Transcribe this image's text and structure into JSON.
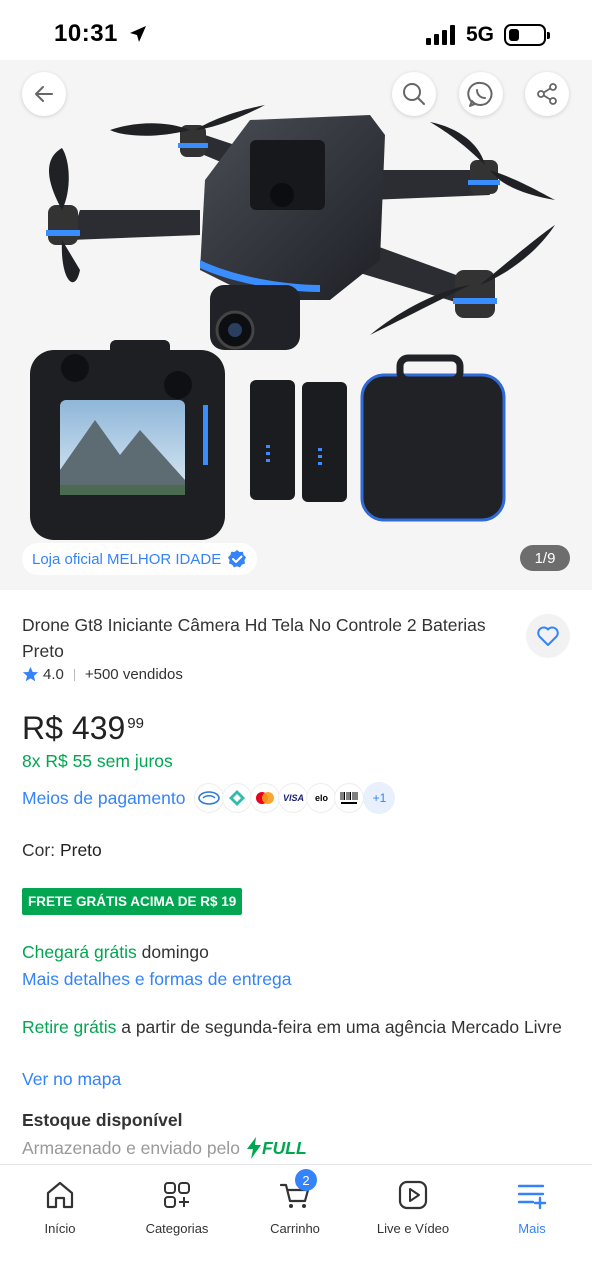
{
  "status_bar": {
    "time": "10:31",
    "network": "5G"
  },
  "hero": {
    "buttons": {
      "back": "back-icon",
      "search": "search-icon",
      "share_whatsapp": "whatsapp-share-icon",
      "share": "share-icon"
    },
    "store_badge": "Loja oficial MELHOR IDADE",
    "image_counter": "1/9"
  },
  "product": {
    "title": "Drone Gt8 Iniciante Câmera Hd Tela No Controle 2 Baterias Preto",
    "rating": "4.0",
    "sold": "+500 vendidos",
    "price_currency": "R$",
    "price_main": "439",
    "price_cents": "99",
    "installments": "8x R$ 55 sem juros",
    "payment_label": "Meios de pagamento",
    "payment_more": "+1",
    "color_label": "Cor:",
    "color_value": "Preto"
  },
  "shipping": {
    "badge": "FRETE GRÁTIS ACIMA DE R$ 19",
    "arrival_green": "Chegará grátis",
    "arrival_rest": "domingo",
    "details_link": "Mais detalhes e formas de entrega",
    "pickup_green": "Retire grátis",
    "pickup_rest": "a partir de segunda-feira em uma agência Mercado Livre",
    "map_link": "Ver no mapa"
  },
  "stock": {
    "title": "Estoque disponível",
    "stored_text": "Armazenado e enviado pelo",
    "full": "FULL"
  },
  "bottom_nav": {
    "items": [
      {
        "label": "Início"
      },
      {
        "label": "Categorias"
      },
      {
        "label": "Carrinho",
        "badge": "2"
      },
      {
        "label": "Live e Vídeo"
      },
      {
        "label": "Mais"
      }
    ]
  },
  "colors": {
    "accent_blue": "#3483fa",
    "success_green": "#00a650"
  }
}
